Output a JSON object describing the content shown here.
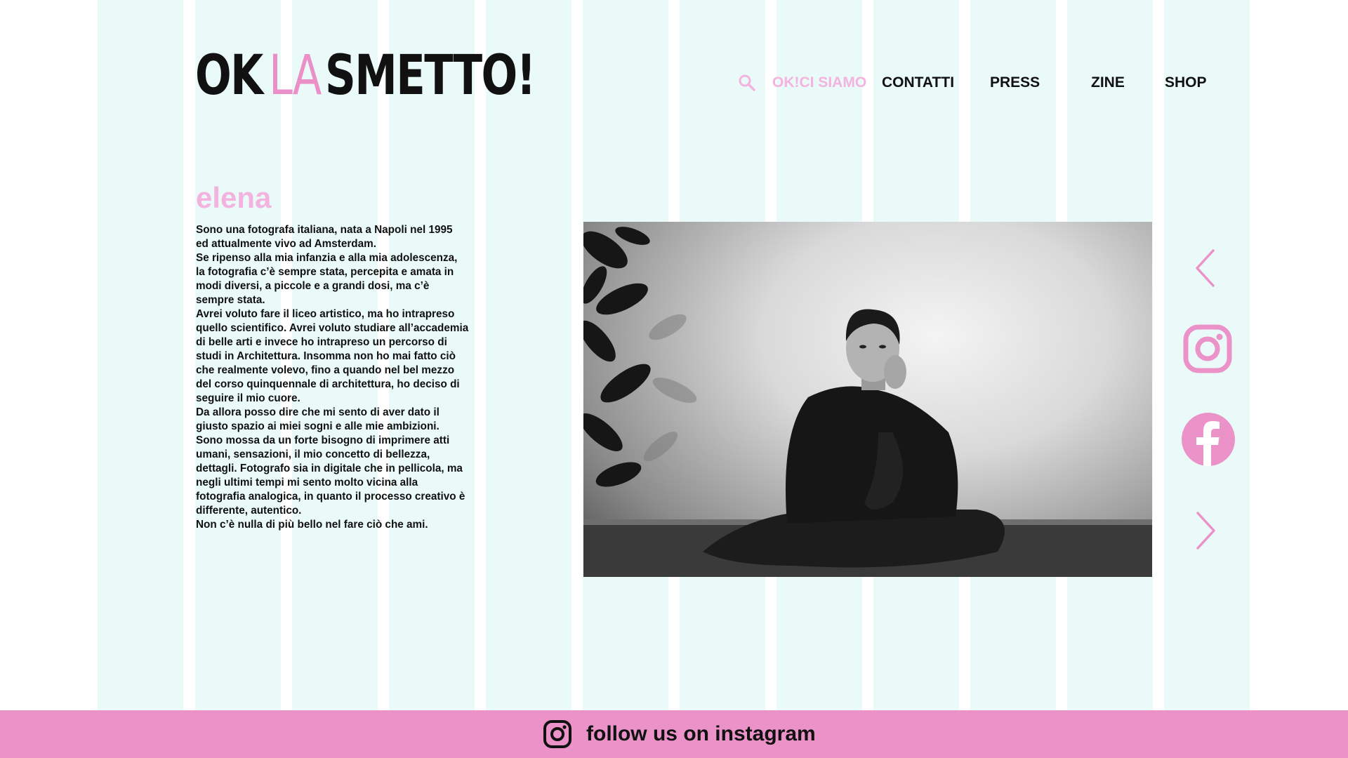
{
  "brand": {
    "logo_part1": "OK",
    "logo_part2": "LA",
    "logo_part3": "SMETTO!"
  },
  "nav": {
    "search_icon": "search-icon",
    "items": [
      {
        "label": "OK!CI SIAMO",
        "active": true
      },
      {
        "label": "CONTATTI",
        "active": false
      },
      {
        "label": "PRESS",
        "active": false
      },
      {
        "label": "ZINE",
        "active": false
      },
      {
        "label": "SHOP",
        "active": false
      }
    ]
  },
  "bio": {
    "name": "elena",
    "lines": [
      "Sono una fotografa italiana, nata a Napoli nel 1995",
      "ed attualmente vivo ad Amsterdam.",
      "Se ripenso alla mia infanzia e alla mia adolescenza,",
      "la fotografia c’è sempre stata, percepita e amata in",
      "modi diversi, a piccole e a grandi dosi, ma c’è",
      "sempre stata.",
      "Avrei voluto fare il liceo artistico, ma ho intrapreso",
      "quello scientifico. Avrei voluto studiare all’accademia",
      "di belle arti e invece ho intrapreso un percorso di",
      "studi in Architettura. Insomma non ho mai fatto ciò",
      "che realmente volevo, fino a quando nel bel mezzo",
      "del corso quinquennale di architettura, ho deciso di",
      "seguire il mio cuore.",
      "Da allora posso dire che mi sento di aver dato il",
      "giusto spazio ai miei sogni e alle mie ambizioni.",
      "Sono mossa da un forte bisogno di imprimere atti",
      "umani, sensazioni, il mio concetto di bellezza,",
      "dettagli. Fotografo sia in digitale che in pellicola, ma",
      "negli ultimi tempi mi sento molto vicina alla",
      "fotografia analogica, in quanto il processo creativo è",
      "differente, autentico.",
      "Non c’è nulla di più bello nel fare ciò che ami."
    ]
  },
  "side": {
    "prev_icon": "chevron-left-icon",
    "instagram_icon": "instagram-icon",
    "facebook_icon": "facebook-icon",
    "next_icon": "chevron-right-icon"
  },
  "footer": {
    "text": "follow us on instagram",
    "icon": "instagram-icon"
  },
  "colors": {
    "pink": "#eb92c8",
    "pink_light": "#f4b3df",
    "stripe": "#eafaf9",
    "text": "#111111"
  }
}
